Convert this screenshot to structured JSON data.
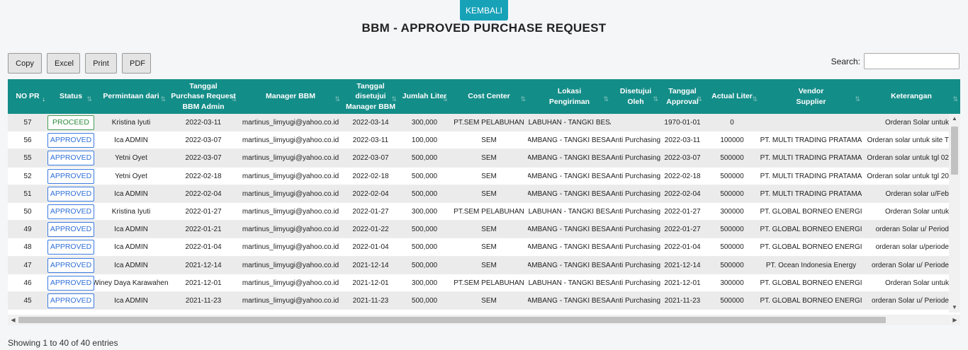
{
  "header": {
    "back_label": "KEMBALI",
    "title": "BBM - APPROVED PURCHASE REQUEST"
  },
  "toolbar": {
    "copy": "Copy",
    "excel": "Excel",
    "print": "Print",
    "pdf": "PDF"
  },
  "search": {
    "label": "Search:",
    "value": ""
  },
  "columns": [
    {
      "label": "NO PR",
      "sorted": true
    },
    {
      "label": "Status"
    },
    {
      "label": "Permintaan dari"
    },
    {
      "label": "Tanggal\nPurchase Request\nBBM Admin"
    },
    {
      "label": "Manager BBM"
    },
    {
      "label": "Tanggal\ndisetujui\nManager BBM"
    },
    {
      "label": "Jumlah Liter"
    },
    {
      "label": "Cost Center"
    },
    {
      "label": "Lokasi\nPengiriman"
    },
    {
      "label": "Disetujui\nOleh"
    },
    {
      "label": "Tanggal\nApproval"
    },
    {
      "label": "Actual Liter"
    },
    {
      "label": "Vendor\nSupplier"
    },
    {
      "label": "Keterangan"
    }
  ],
  "rows": [
    [
      "57",
      "PROCEED",
      "Kristina Iyuti",
      "2022-03-11",
      "martinus_limyugi@yahoo.co.id",
      "2022-03-14",
      "300,000",
      "PT.SEM PELABUHAN",
      "PELABUHAN - TANGKI BESAR",
      "",
      "1970-01-01",
      "0",
      "",
      "Orderan Solar untuk"
    ],
    [
      "56",
      "APPROVED",
      "Ica ADMIN",
      "2022-03-07",
      "martinus_limyugi@yahoo.co.id",
      "2022-03-11",
      "100,000",
      "SEM",
      "TAMBANG - TANGKI BESAR",
      "Anti Purchasing",
      "2022-03-11",
      "100000",
      "PT. MULTI TRADING PRATAMA",
      "Orderan solar untuk site T"
    ],
    [
      "55",
      "APPROVED",
      "Yetni Oyet",
      "2022-03-07",
      "martinus_limyugi@yahoo.co.id",
      "2022-03-07",
      "500,000",
      "SEM",
      "TAMBANG - TANGKI BESAR",
      "Anti Purchasing",
      "2022-03-07",
      "500000",
      "PT. MULTI TRADING PRATAMA",
      "Orderan solar untuk tgl 02"
    ],
    [
      "52",
      "APPROVED",
      "Yetni Oyet",
      "2022-02-18",
      "martinus_limyugi@yahoo.co.id",
      "2022-02-18",
      "500,000",
      "SEM",
      "TAMBANG - TANGKI BESAR",
      "Anti Purchasing",
      "2022-02-18",
      "500000",
      "PT. MULTI TRADING PRATAMA",
      "Orderan solar untuk tgl 20"
    ],
    [
      "51",
      "APPROVED",
      "Ica ADMIN",
      "2022-02-04",
      "martinus_limyugi@yahoo.co.id",
      "2022-02-04",
      "500,000",
      "SEM",
      "TAMBANG - TANGKI BESAR",
      "Anti Purchasing",
      "2022-02-04",
      "500000",
      "PT. MULTI TRADING PRATAMA",
      "Orderan solar u/Feb"
    ],
    [
      "50",
      "APPROVED",
      "Kristina Iyuti",
      "2022-01-27",
      "martinus_limyugi@yahoo.co.id",
      "2022-01-27",
      "300,000",
      "PT.SEM PELABUHAN",
      "PELABUHAN - TANGKI BESAR",
      "Anti Purchasing",
      "2022-01-27",
      "300000",
      "PT. GLOBAL BORNEO ENERGI",
      "Orderan Solar untuk"
    ],
    [
      "49",
      "APPROVED",
      "Ica ADMIN",
      "2022-01-21",
      "martinus_limyugi@yahoo.co.id",
      "2022-01-22",
      "500,000",
      "SEM",
      "TAMBANG - TANGKI BESAR",
      "Anti Purchasing",
      "2022-01-27",
      "500000",
      "PT. GLOBAL BORNEO ENERGI",
      "orderan Solar u/ Period"
    ],
    [
      "48",
      "APPROVED",
      "Ica ADMIN",
      "2022-01-04",
      "martinus_limyugi@yahoo.co.id",
      "2022-01-04",
      "500,000",
      "SEM",
      "TAMBANG - TANGKI BESAR",
      "Anti Purchasing",
      "2022-01-04",
      "500000",
      "PT. GLOBAL BORNEO ENERGI",
      "orderan solar u/periode"
    ],
    [
      "47",
      "APPROVED",
      "Ica ADMIN",
      "2021-12-14",
      "martinus_limyugi@yahoo.co.id",
      "2021-12-14",
      "500,000",
      "SEM",
      "TAMBANG - TANGKI BESAR",
      "Anti Purchasing",
      "2021-12-14",
      "500000",
      "PT. Ocean Indonesia Energy",
      "orderan Solar u/ Periode"
    ],
    [
      "46",
      "APPROVED",
      "Winey Daya Karawaheni",
      "2021-12-01",
      "martinus_limyugi@yahoo.co.id",
      "2021-12-01",
      "300,000",
      "PT.SEM PELABUHAN",
      "PELABUHAN - TANGKI BESAR",
      "Anti Purchasing",
      "2021-12-01",
      "300000",
      "PT. GLOBAL BORNEO ENERGI",
      "Orderan Solar untuk"
    ],
    [
      "45",
      "APPROVED",
      "Ica ADMIN",
      "2021-11-23",
      "martinus_limyugi@yahoo.co.id",
      "2021-11-23",
      "500,000",
      "SEM",
      "TAMBANG - TANGKI BESAR",
      "Anti Purchasing",
      "2021-11-23",
      "500000",
      "PT. GLOBAL BORNEO ENERGI",
      "orderan Solar u/ Periode"
    ]
  ],
  "footer": {
    "info": "Showing 1 to 40 of 40 entries"
  },
  "colors": {
    "header_bg": "#138d88",
    "back_btn": "#17a2b8",
    "approved": "#2f6fd8",
    "proceed": "#2c8a3a"
  }
}
